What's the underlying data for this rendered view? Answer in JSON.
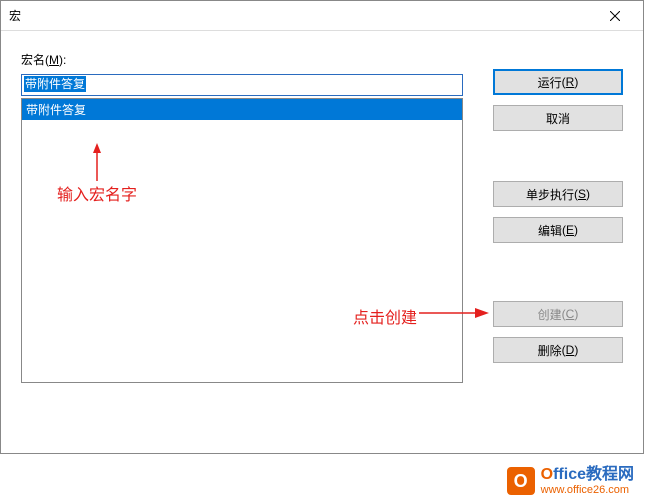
{
  "window": {
    "title": "宏"
  },
  "labels": {
    "macroName": "宏名",
    "macroNameKey": "M"
  },
  "input": {
    "value": "带附件答复"
  },
  "list": {
    "items": [
      "带附件答复"
    ]
  },
  "buttons": {
    "run": "运行",
    "runKey": "R",
    "cancel": "取消",
    "step": "单步执行",
    "stepKey": "S",
    "edit": "编辑",
    "editKey": "E",
    "create": "创建",
    "createKey": "C",
    "delete": "删除",
    "deleteKey": "D"
  },
  "annotations": {
    "inputHint": "输入宏名字",
    "createHint": "点击创建"
  },
  "watermark": {
    "logo": "O",
    "titleO": "O",
    "titleRest": "ffice教程网",
    "url": "www.office26.com"
  }
}
